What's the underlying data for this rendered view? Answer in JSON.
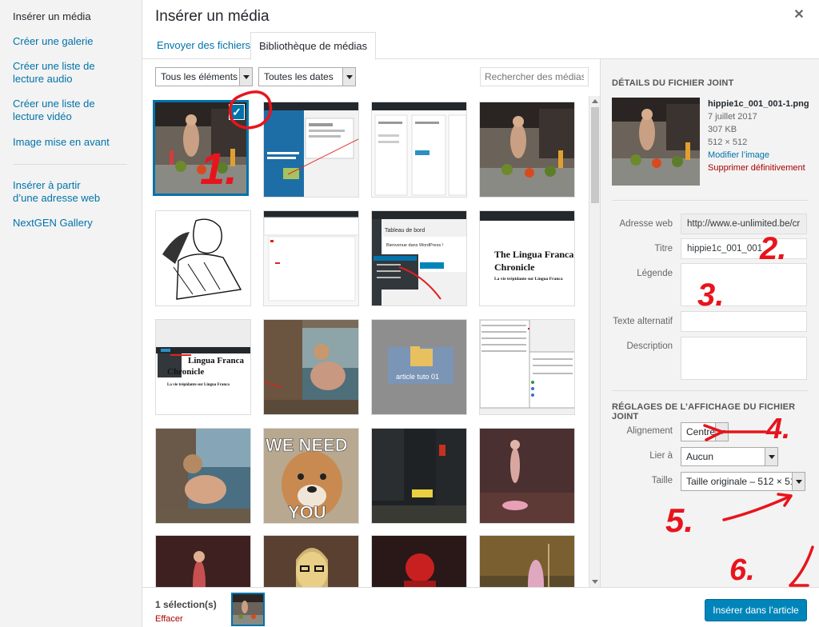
{
  "menu": {
    "items": [
      {
        "label": "Insérer un média"
      },
      {
        "label": "Créer une galerie"
      },
      {
        "label": "Créer une liste de lecture audio"
      },
      {
        "label": "Créer une liste de lecture vidéo"
      },
      {
        "label": "Image mise en avant"
      },
      {
        "label": "Insérer à partir d’une adresse web"
      },
      {
        "label": "NextGEN Gallery"
      }
    ]
  },
  "header": {
    "title": "Insérer un média",
    "close": "✕"
  },
  "tabs": [
    {
      "label": "Envoyer des fichiers"
    },
    {
      "label": "Bibliothèque de médias"
    }
  ],
  "toolbar": {
    "filter_type": "Tous les éléments m",
    "filter_date": "Toutes les dates",
    "search_placeholder": "Rechercher des médias..."
  },
  "grid": {
    "selected_check": "✓",
    "texts": {
      "we_need": "WE NEED",
      "you": "YOU",
      "lingua_1": "The Lingua Franca",
      "lingua_2": "Chronicle",
      "lingua_tag": "La vie trépidante sur Lingua Franca",
      "lingua_b1": "Lingua Franca",
      "lingua_b2": "Chronicle",
      "lingua_btag": "La vie trépidante sur Lingua Franca",
      "folder": "article tuto 01",
      "dash_title": "Tableau de bord",
      "dash_welcome": "Bienvenue dans WordPress !"
    }
  },
  "details": {
    "heading": "Détails du fichier joint",
    "filename": "hippie1c_001_001-1.png",
    "date": "7 juillet 2017",
    "size": "307 KB",
    "dims": "512 × 512",
    "edit_link": "Modifier l’image",
    "delete_link": "Supprimer définitivement",
    "url_label": "Adresse web",
    "url_value": "http://www.e-unlimited.be/cr",
    "title_label": "Titre",
    "title_value": "hippie1c_001_001",
    "caption_label": "Légende",
    "alt_label": "Texte alternatif",
    "desc_label": "Description"
  },
  "display": {
    "heading": "Réglages de l’affichage du fichier joint",
    "align_label": "Alignement",
    "align_value": "Centre",
    "link_label": "Lier à",
    "link_value": "Aucun",
    "size_label": "Taille",
    "size_value": "Taille originale – 512 × 512"
  },
  "footer": {
    "selection_count": "1 sélection(s)",
    "clear": "Effacer",
    "insert_button": "Insérer dans l’article"
  },
  "annotations": [
    "1.",
    "2.",
    "3.",
    "4.",
    "5.",
    "6."
  ],
  "colors": {
    "accent": "#0073aa",
    "button": "#0085ba",
    "danger": "#a00",
    "annotation": "#e8141c"
  }
}
